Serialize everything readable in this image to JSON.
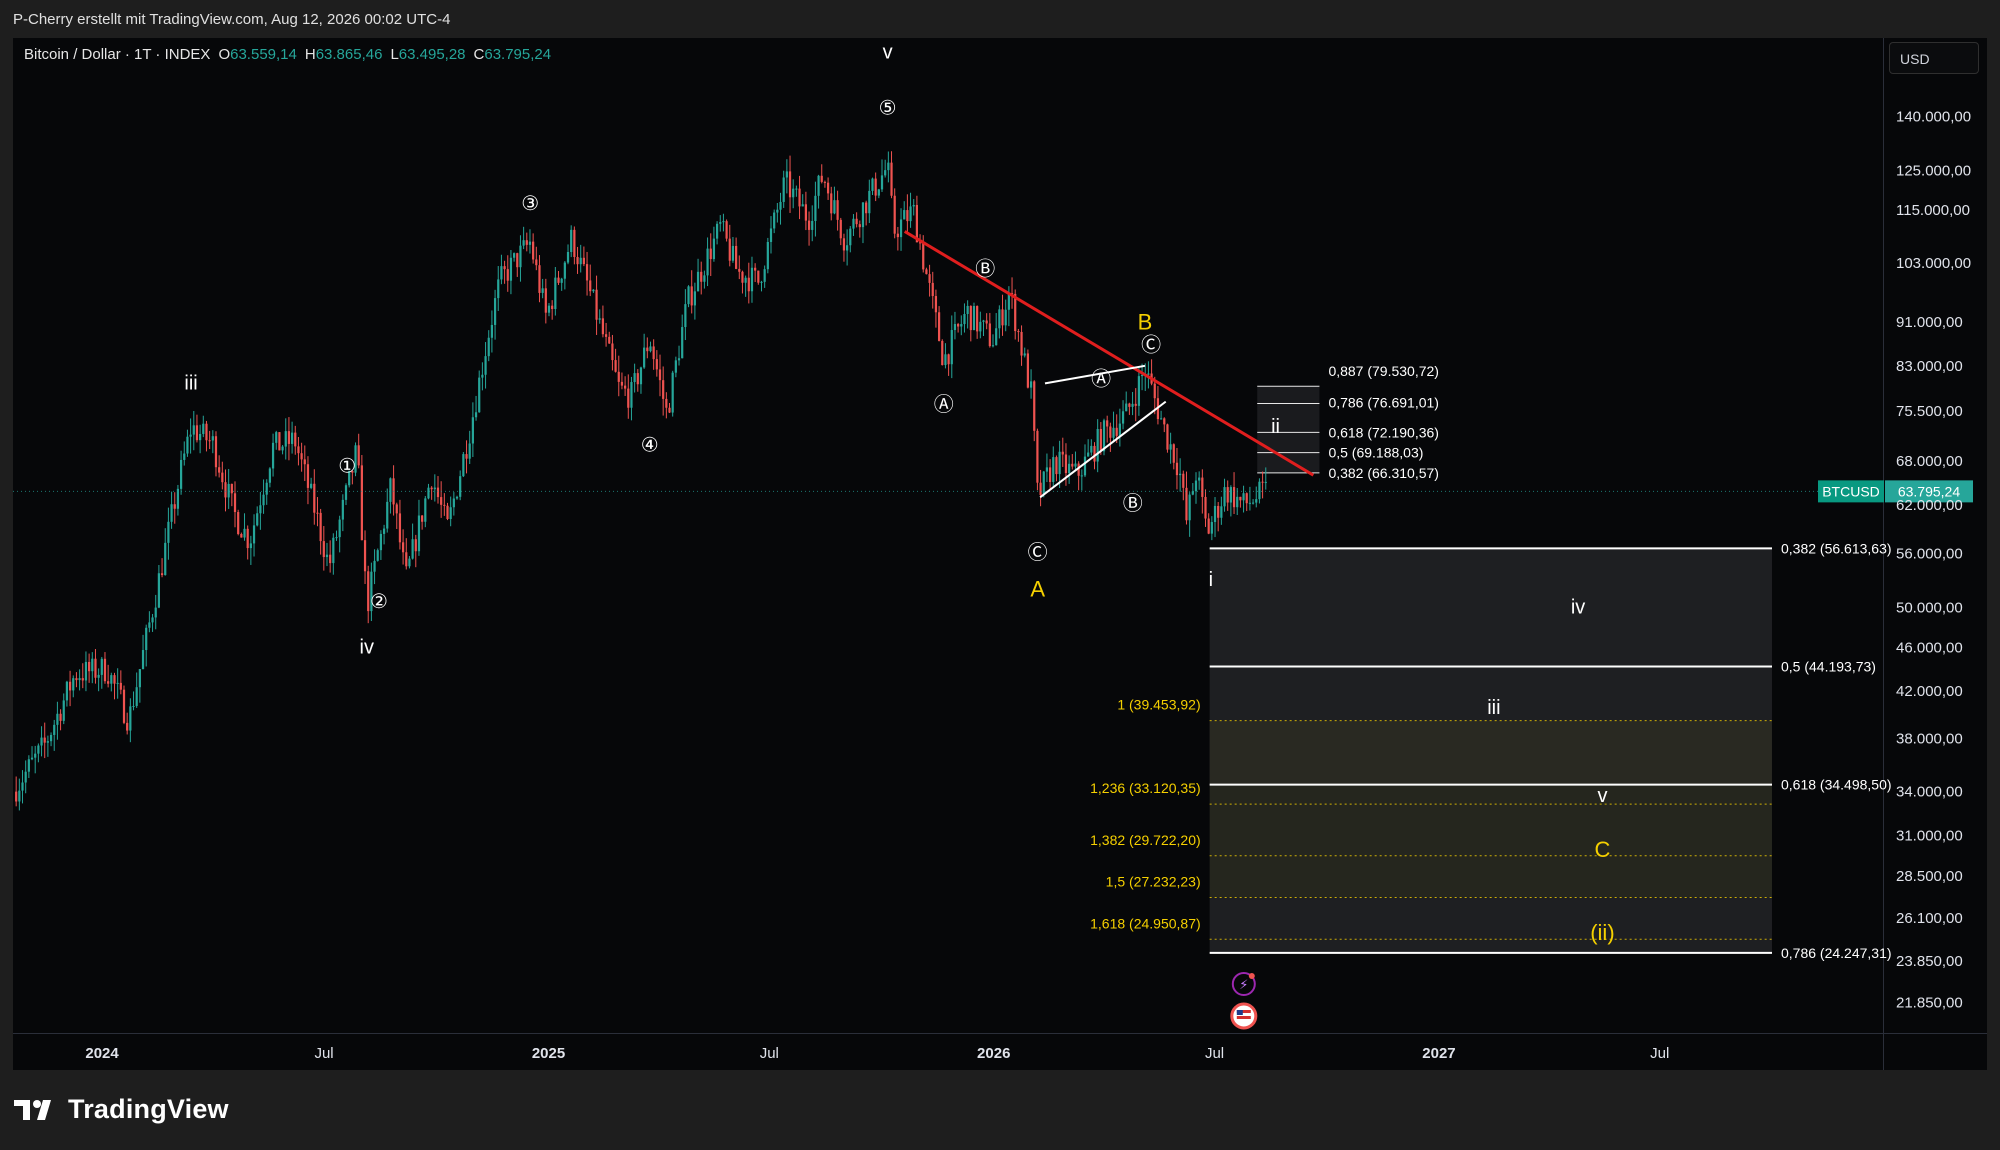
{
  "header": {
    "attribution": "P-Cherry erstellt mit TradingView.com, Aug 12, 2026 00:02 UTC-4"
  },
  "legend": {
    "symbol": "Bitcoin / Dollar · 1T · INDEX",
    "o_label": "O",
    "o_value": "63.559,14",
    "h_label": "H",
    "h_value": "63.865,46",
    "l_label": "L",
    "l_value": "63.495,28",
    "c_label": "C",
    "c_value": "63.795,24"
  },
  "currency_button": "USD",
  "price_tag": {
    "symbol": "BTCUSD",
    "value": "63.795,24",
    "symbol_color": "#089981",
    "value_color": "#26a69a"
  },
  "footer": {
    "brand": "TradingView"
  },
  "colors": {
    "bull": "#26a69a",
    "bear": "#ef5350",
    "trendline": "#e01e1e",
    "fib_yellow": "#f5d000",
    "zone_bg": "#1e1f22",
    "zone_bg_yellow": "#2b2b22"
  },
  "chart_data": {
    "type": "candlestick",
    "symbol": "BTCUSD",
    "y_scale": "log",
    "ylim": [
      20500,
      165000
    ],
    "y_ticks": [
      {
        "value": 140000,
        "label": "140.000,00"
      },
      {
        "value": 125000,
        "label": "125.000,00"
      },
      {
        "value": 115000,
        "label": "115.000,00"
      },
      {
        "value": 103000,
        "label": "103.000,00"
      },
      {
        "value": 91000,
        "label": "91.000,00"
      },
      {
        "value": 83000,
        "label": "83.000,00"
      },
      {
        "value": 75500,
        "label": "75.500,00"
      },
      {
        "value": 68000,
        "label": "68.000,00"
      },
      {
        "value": 62000,
        "label": "62.000,00"
      },
      {
        "value": 56000,
        "label": "56.000,00"
      },
      {
        "value": 50000,
        "label": "50.000,00"
      },
      {
        "value": 46000,
        "label": "46.000,00"
      },
      {
        "value": 42000,
        "label": "42.000,00"
      },
      {
        "value": 38000,
        "label": "38.000,00"
      },
      {
        "value": 34000,
        "label": "34.000,00"
      },
      {
        "value": 31000,
        "label": "31.000,00"
      },
      {
        "value": 28500,
        "label": "28.500,00"
      },
      {
        "value": 26100,
        "label": "26.100,00"
      },
      {
        "value": 23850,
        "label": "23.850,00"
      },
      {
        "value": 21850,
        "label": "21.850,00"
      }
    ],
    "x_ticks": [
      {
        "date": "2024-01-01",
        "label": "2024",
        "bold": true
      },
      {
        "date": "2024-07-01",
        "label": "Jul",
        "bold": false
      },
      {
        "date": "2025-01-01",
        "label": "2025",
        "bold": true
      },
      {
        "date": "2025-07-01",
        "label": "Jul",
        "bold": false
      },
      {
        "date": "2026-01-01",
        "label": "2026",
        "bold": true
      },
      {
        "date": "2026-07-01",
        "label": "Jul",
        "bold": false
      },
      {
        "date": "2027-01-01",
        "label": "2027",
        "bold": true
      },
      {
        "date": "2027-07-01",
        "label": "Jul",
        "bold": false
      }
    ],
    "xlim": [
      "2023-10-20",
      "2027-12-31"
    ],
    "last_price": 63795.24,
    "price_path": [
      [
        "2023-10-20",
        34000
      ],
      [
        "2023-11-15",
        37500
      ],
      [
        "2023-12-10",
        43500
      ],
      [
        "2024-01-05",
        44000
      ],
      [
        "2024-01-23",
        39500
      ],
      [
        "2024-02-15",
        52000
      ],
      [
        "2024-03-05",
        66000
      ],
      [
        "2024-03-14",
        73000
      ],
      [
        "2024-04-01",
        70500
      ],
      [
        "2024-04-18",
        61000
      ],
      [
        "2024-05-01",
        57500
      ],
      [
        "2024-05-20",
        70000
      ],
      [
        "2024-06-07",
        71000
      ],
      [
        "2024-06-25",
        60500
      ],
      [
        "2024-07-05",
        54500
      ],
      [
        "2024-07-28",
        69500
      ],
      [
        "2024-08-05",
        50000
      ],
      [
        "2024-08-25",
        64500
      ],
      [
        "2024-09-06",
        53000
      ],
      [
        "2024-09-27",
        66000
      ],
      [
        "2024-10-10",
        59000
      ],
      [
        "2024-10-29",
        73000
      ],
      [
        "2024-11-13",
        89000
      ],
      [
        "2024-11-22",
        99000
      ],
      [
        "2024-12-05",
        103500
      ],
      [
        "2024-12-17",
        107500
      ],
      [
        "2024-12-30",
        92000
      ],
      [
        "2025-01-20",
        108500
      ],
      [
        "2025-02-05",
        96000
      ],
      [
        "2025-02-28",
        79000
      ],
      [
        "2025-03-10",
        78000
      ],
      [
        "2025-03-25",
        88000
      ],
      [
        "2025-04-08",
        75000
      ],
      [
        "2025-04-25",
        95000
      ],
      [
        "2025-05-22",
        111000
      ],
      [
        "2025-06-05",
        101000
      ],
      [
        "2025-06-22",
        99000
      ],
      [
        "2025-07-14",
        122000
      ],
      [
        "2025-08-02",
        113000
      ],
      [
        "2025-08-14",
        124000
      ],
      [
        "2025-09-01",
        108000
      ],
      [
        "2025-09-18",
        117000
      ],
      [
        "2025-10-06",
        126000
      ],
      [
        "2025-10-11",
        110000
      ],
      [
        "2025-10-27",
        115000
      ],
      [
        "2025-11-21",
        84000
      ],
      [
        "2025-12-10",
        93000
      ],
      [
        "2025-12-31",
        87500
      ],
      [
        "2026-01-14",
        97000
      ],
      [
        "2026-02-01",
        78000
      ],
      [
        "2026-02-06",
        63000
      ],
      [
        "2026-02-20",
        68000
      ],
      [
        "2026-03-10",
        66000
      ],
      [
        "2026-04-01",
        72000
      ],
      [
        "2026-04-20",
        75000
      ],
      [
        "2026-05-05",
        82500
      ],
      [
        "2026-05-22",
        72000
      ],
      [
        "2026-06-02",
        67000
      ],
      [
        "2026-06-08",
        60000
      ],
      [
        "2026-06-16",
        66500
      ],
      [
        "2026-06-25",
        58500
      ],
      [
        "2026-07-10",
        64000
      ],
      [
        "2026-07-25",
        62000
      ],
      [
        "2026-08-12",
        63795.24
      ]
    ],
    "wave_labels": [
      {
        "text": "v",
        "date": "2025-10-06",
        "price": 160000,
        "color": "white"
      },
      {
        "text": "iii",
        "date": "2024-03-14",
        "price": 80000,
        "color": "white"
      },
      {
        "text": "iv",
        "date": "2024-08-05",
        "price": 46000,
        "color": "white"
      },
      {
        "text": "A",
        "date": "2026-02-06",
        "price": 52000,
        "color": "yellow"
      },
      {
        "text": "B",
        "date": "2026-05-05",
        "price": 91000,
        "color": "yellow"
      },
      {
        "text": "ii",
        "date": "2026-08-20",
        "price": 73000,
        "color": "white"
      },
      {
        "text": "i",
        "date": "2026-06-28",
        "price": 53000,
        "color": "white"
      },
      {
        "text": "iv",
        "date": "2027-04-25",
        "price": 50000,
        "color": "white"
      },
      {
        "text": "iii",
        "date": "2027-02-15",
        "price": 40500,
        "color": "white"
      },
      {
        "text": "v",
        "date": "2027-05-15",
        "price": 33700,
        "color": "white"
      },
      {
        "text": "C",
        "date": "2027-05-15",
        "price": 30100,
        "color": "yellow"
      },
      {
        "text": "(ii)",
        "date": "2027-05-15",
        "price": 25300,
        "color": "yellow"
      }
    ],
    "circled_labels": [
      {
        "text": "①",
        "date": "2024-07-20",
        "price": 67500
      },
      {
        "text": "②",
        "date": "2024-08-15",
        "price": 50800
      },
      {
        "text": "③",
        "date": "2024-12-17",
        "price": 117000
      },
      {
        "text": "④",
        "date": "2025-03-25",
        "price": 70500
      },
      {
        "text": "⑤",
        "date": "2025-10-06",
        "price": 143000
      },
      {
        "text": "Ⓐ",
        "date": "2025-11-21",
        "price": 76800
      },
      {
        "text": "Ⓑ",
        "date": "2025-12-25",
        "price": 102000
      },
      {
        "text": "Ⓒ",
        "date": "2026-02-06",
        "price": 56300
      },
      {
        "text": "Ⓐ",
        "date": "2026-03-30",
        "price": 81000
      },
      {
        "text": "Ⓑ",
        "date": "2026-04-25",
        "price": 62400
      },
      {
        "text": "Ⓒ",
        "date": "2026-05-10",
        "price": 87000
      }
    ],
    "trendline": {
      "from": [
        "2025-10-20",
        110000
      ],
      "to": [
        "2026-09-20",
        66000
      ]
    },
    "channel_lines": [
      {
        "from": [
          "2026-02-12",
          80000
        ],
        "to": [
          "2026-05-05",
          83000
        ]
      },
      {
        "from": [
          "2026-02-08",
          63000
        ],
        "to": [
          "2026-05-22",
          77000
        ]
      }
    ],
    "retrace_levels": {
      "x_from": "2026-08-05",
      "x_to": "2026-09-25",
      "levels": [
        {
          "label": "0,887 (79.530,72)",
          "value": 79530.72
        },
        {
          "label": "0,786 (76.691,01)",
          "value": 76691.01
        },
        {
          "label": "0,618 (72.190,36)",
          "value": 72190.36
        },
        {
          "label": "0,5 (69.188,03)",
          "value": 69188.03
        },
        {
          "label": "0,382 (66.310,57)",
          "value": 66310.57
        }
      ]
    },
    "target_zone": {
      "x_from": "2026-06-27",
      "x_to": "2027-10-01",
      "white_levels": [
        {
          "label": "0,382 (56.613,63)",
          "value": 56613.63
        },
        {
          "label": "0,5 (44.193,73)",
          "value": 44193.73
        },
        {
          "label": "0,618 (34.498,50)",
          "value": 34498.5
        },
        {
          "label": "0,786 (24.247,31)",
          "value": 24247.31
        }
      ],
      "yellow_levels": [
        {
          "label": "1 (39.453,92)",
          "value": 39453.92
        },
        {
          "label": "1,236 (33.120,35)",
          "value": 33120.35
        },
        {
          "label": "1,382 (29.722,20)",
          "value": 29722.2
        },
        {
          "label": "1,5 (27.232,23)",
          "value": 27232.23
        },
        {
          "label": "1,618 (24.950,87)",
          "value": 24950.87
        }
      ]
    }
  }
}
